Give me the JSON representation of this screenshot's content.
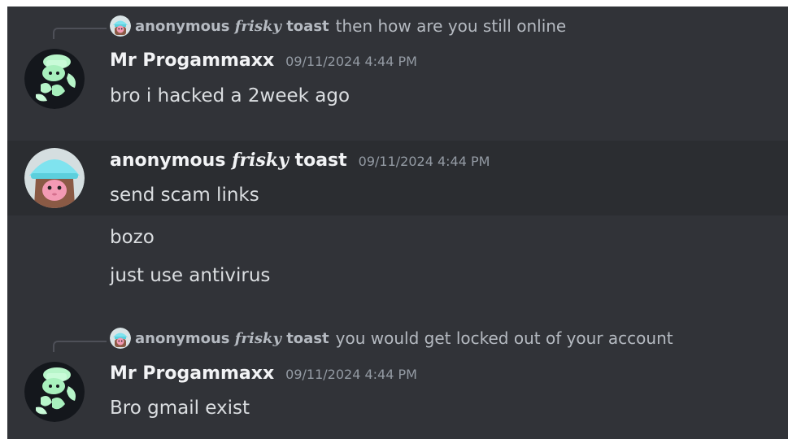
{
  "messages": [
    {
      "reply": {
        "author": {
          "pre": "anonymous ",
          "fancy": "frisky",
          "post": " toast"
        },
        "text": "then how are you still online"
      },
      "author": "Mr Progammaxx",
      "timestamp": "09/11/2024 4:44 PM",
      "lines": [
        "bro i hacked a 2week ago"
      ]
    },
    {
      "author": {
        "pre": "anonymous ",
        "fancy": "frisky",
        "post": " toast"
      },
      "timestamp": "09/11/2024 4:44 PM",
      "lines": [
        "send scam links",
        "bozo",
        "just use antivirus"
      ]
    },
    {
      "reply": {
        "author": {
          "pre": "anonymous ",
          "fancy": "frisky",
          "post": " toast"
        },
        "text": "you would get locked out of your account"
      },
      "author": "Mr Progammaxx",
      "timestamp": "09/11/2024 4:44 PM",
      "lines": [
        "Bro gmail exist"
      ]
    }
  ],
  "icons": {
    "progammaxx_avatar": "green-mascot-avatar-icon",
    "toast_avatar": "pink-bob-hat-avatar-icon"
  },
  "colors": {
    "background": "#313338",
    "hover_background": "#2b2d31",
    "username": "#f2f3f5",
    "timestamp": "#949ba4",
    "message_text": "#dbdee1",
    "avatar_green": "#b7f5c9"
  }
}
